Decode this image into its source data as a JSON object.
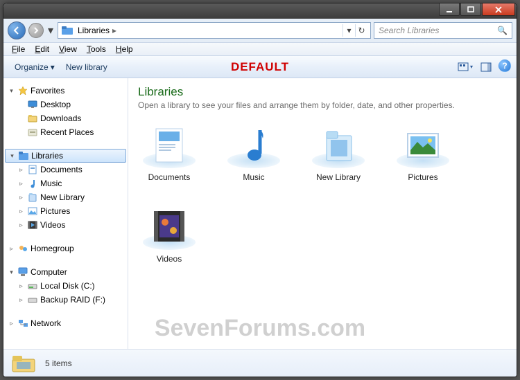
{
  "titlebar": {
    "min": "_",
    "max": "▭",
    "close": "✕"
  },
  "nav": {
    "back_arrow": "←",
    "fwd_arrow": "→",
    "history_drop": "▾",
    "breadcrumb": [
      "Libraries"
    ],
    "addr_drop": "▾",
    "refresh": "↻",
    "search_placeholder": "Search Libraries",
    "search_icon": "🔍"
  },
  "menubar": [
    {
      "letter": "F",
      "rest": "ile"
    },
    {
      "letter": "E",
      "rest": "dit"
    },
    {
      "letter": "V",
      "rest": "iew"
    },
    {
      "letter": "T",
      "rest": "ools"
    },
    {
      "letter": "H",
      "rest": "elp"
    }
  ],
  "toolbar": {
    "organize": "Organize",
    "organize_drop": "▾",
    "newlib": "New library",
    "overlay_text": "DEFAULT",
    "view_drop": "▾",
    "help": "?"
  },
  "tree": {
    "favorites": {
      "label": "Favorites",
      "items": [
        {
          "label": "Desktop"
        },
        {
          "label": "Downloads"
        },
        {
          "label": "Recent Places"
        }
      ]
    },
    "libraries": {
      "label": "Libraries",
      "items": [
        {
          "label": "Documents"
        },
        {
          "label": "Music"
        },
        {
          "label": "New Library"
        },
        {
          "label": "Pictures"
        },
        {
          "label": "Videos"
        }
      ]
    },
    "homegroup": {
      "label": "Homegroup"
    },
    "computer": {
      "label": "Computer",
      "items": [
        {
          "label": "Local Disk (C:)"
        },
        {
          "label": "Backup RAID (F:)"
        }
      ]
    },
    "network": {
      "label": "Network"
    }
  },
  "content": {
    "title": "Libraries",
    "subtitle": "Open a library to see your files and arrange them by folder, date, and other properties.",
    "items": [
      {
        "label": "Documents"
      },
      {
        "label": "Music"
      },
      {
        "label": "New Library"
      },
      {
        "label": "Pictures"
      },
      {
        "label": "Videos"
      }
    ]
  },
  "status": {
    "count_text": "5 items"
  },
  "watermark": "SevenForums.com"
}
